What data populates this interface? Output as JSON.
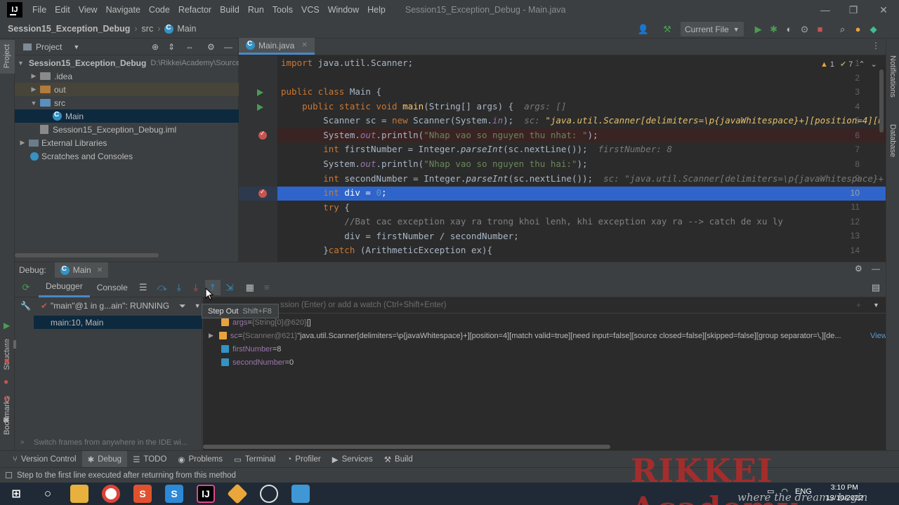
{
  "app": {
    "menu": [
      "File",
      "Edit",
      "View",
      "Navigate",
      "Code",
      "Refactor",
      "Build",
      "Run",
      "Tools",
      "VCS",
      "Window",
      "Help"
    ],
    "window_title": "Session15_Exception_Debug - Main.java"
  },
  "navbar": {
    "project": "Session15_Exception_Debug",
    "folder": "src",
    "file": "Main",
    "run_config": "Current File"
  },
  "project_panel": {
    "title": "Project",
    "root": "Session15_Exception_Debug",
    "root_path": "D:\\RikkeiAcademy\\Source",
    "items": [
      ".idea",
      "out",
      "src",
      "Main",
      "Session15_Exception_Debug.iml",
      "External Libraries",
      "Scratches and Consoles"
    ]
  },
  "editor": {
    "tab": "Main.java",
    "warnings": "1",
    "weak_warnings": "7",
    "line_numbers": [
      "1",
      "2",
      "3",
      "4",
      "5",
      "6",
      "7",
      "8",
      "9",
      "10",
      "11",
      "12",
      "13",
      "14"
    ],
    "code": {
      "l1_kw": "import",
      "l1_rest": " java.util.Scanner;",
      "l3_kw": "public class",
      "l3_rest": " Main {",
      "l4_kw": "    public static void",
      "l4_fn": " main",
      "l4_rest": "(String[] args) {  ",
      "l4_hint": "args: []",
      "l5_a": "        Scanner sc = ",
      "l5_kw": "new",
      "l5_b": " Scanner(System.",
      "l5_fld": "in",
      "l5_c": ");  ",
      "l5_hint": "sc: ",
      "l5_hint_str": "\"java.util.Scanner[delimiters=\\p{javaWhitespace}+][position=4][m",
      "l6_a": "        System.",
      "l6_fld": "out",
      "l6_b": ".println(",
      "l6_str": "\"Nhap vao so nguyen thu nhat: \"",
      "l6_c": ");",
      "l7_kw": "        int",
      "l7_a": " firstNumber = Integer.",
      "l7_it": "parseInt",
      "l7_b": "(sc.nextLine());  ",
      "l7_hint": "firstNumber: 8",
      "l8_a": "        System.",
      "l8_fld": "out",
      "l8_b": ".println(",
      "l8_str": "\"Nhap vao so nguyen thu hai:\"",
      "l8_c": ");",
      "l9_kw": "        int",
      "l9_a": " secondNumber = Integer.",
      "l9_it": "parseInt",
      "l9_b": "(sc.nextLine());  ",
      "l9_hint": "sc: \"java.util.Scanner[delimiters=\\p{javaWhitespace}+",
      "l10_kw": "        int",
      "l10_a": " div = ",
      "l10_num": "0",
      "l10_b": ";",
      "l11_kw": "        try",
      "l11_a": " {",
      "l12": "            //Bat cac exception xay ra trong khoi lenh, khi exception xay ra --> catch de xu ly",
      "l13": "            div = firstNumber / secondNumber;",
      "l14_a": "        }",
      "l14_kw": "catch",
      "l14_b": " (ArithmeticException ex){"
    }
  },
  "debug": {
    "label": "Debug:",
    "session": "Main",
    "tabs": [
      "Debugger",
      "Console"
    ],
    "thread": "\"main\"@1 in g...ain\": RUNNING",
    "frame": "main:10, Main",
    "frames_hint": "Switch frames from anywhere in the IDE wi...",
    "eval_placeholder": "ssion (Enter) or add a watch (Ctrl+Shift+Enter)",
    "tooltip_title": "Step Out",
    "tooltip_key": "Shift+F8",
    "variables": [
      {
        "name": "args",
        "eq": " = ",
        "type": "{String[0]@620}",
        "val": " []"
      },
      {
        "name": "sc",
        "eq": " = ",
        "type": "{Scanner@621}",
        "val": " \"java.util.Scanner[delimiters=\\p{javaWhitespace}+][position=4][match valid=true][need input=false][source closed=false][skipped=false][group separator=\\,][de...",
        "link": "View"
      },
      {
        "name": "firstNumber",
        "eq": " = ",
        "val": "8"
      },
      {
        "name": "secondNumber",
        "eq": " = ",
        "val": "0"
      }
    ]
  },
  "bottom_tabs": [
    "Version Control",
    "Debug",
    "TODO",
    "Problems",
    "Terminal",
    "Profiler",
    "Services",
    "Build"
  ],
  "status": "Step to the first line executed after returning from this method",
  "side_labels": {
    "left_top": "Project",
    "left_mid": "Structure",
    "left_bottom": "Bookmarks",
    "right_top": "Notifications",
    "right_mid": "Database"
  },
  "tray": {
    "lang": "ENG",
    "time": "3:10 PM",
    "date": "13/10/2022"
  },
  "watermark": {
    "brand": "RIKKEI Academy",
    "slogan": "where the dreams begin"
  },
  "colors": {
    "accent": "#4a88c7",
    "breakpoint": "#c75450",
    "selection": "#2f65ca",
    "run": "#499c54"
  }
}
